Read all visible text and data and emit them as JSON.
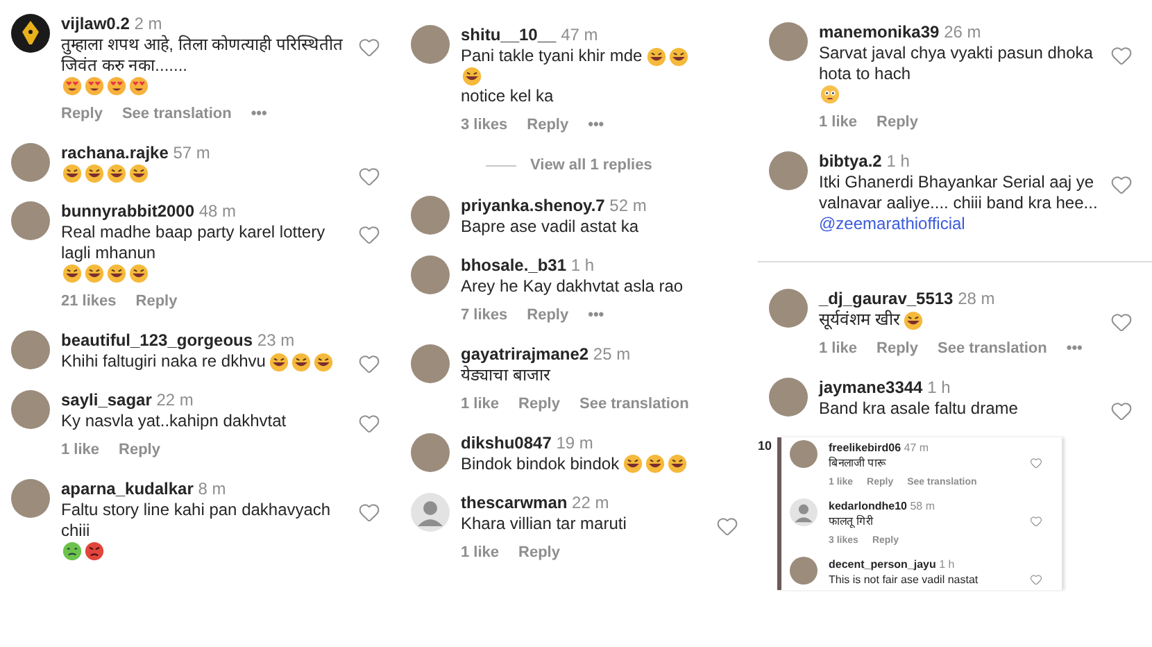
{
  "columns": [
    {
      "items": [
        {
          "kind": "comment",
          "avatar": {
            "kind": "logo"
          },
          "user": "vijlaw0.2",
          "time": "2 m",
          "text": "तुम्हाला शपथ आहे, तिला कोणत्याही परिस्थितीत जिवंत करु नका.......",
          "emojis": [
            {
              "kind": "heart-eyes"
            },
            {
              "kind": "heart-eyes"
            },
            {
              "kind": "heart-eyes"
            },
            {
              "kind": "heart-eyes"
            }
          ],
          "actions": [
            "Reply",
            "See translation",
            "•••"
          ],
          "show_heart": true
        },
        {
          "kind": "comment",
          "avatar": {
            "kind": "photo"
          },
          "user": "rachana.rajke",
          "time": "57 m",
          "emojis": [
            {
              "kind": "laugh"
            },
            {
              "kind": "laugh"
            },
            {
              "kind": "laugh"
            },
            {
              "kind": "laugh"
            }
          ],
          "show_heart": true
        },
        {
          "kind": "comment",
          "avatar": {
            "kind": "photo"
          },
          "user": "bunnyrabbit2000",
          "time": "48 m",
          "text": "Real madhe baap party karel lottery lagli mhanun",
          "emojis": [
            {
              "kind": "laugh"
            },
            {
              "kind": "laugh"
            },
            {
              "kind": "laugh"
            },
            {
              "kind": "laugh"
            }
          ],
          "actions": [
            "21 likes",
            "Reply"
          ],
          "show_heart": true
        },
        {
          "kind": "comment",
          "avatar": {
            "kind": "photo"
          },
          "user": "beautiful_123_gorgeous",
          "time": "23 m",
          "text": "Khihi faltugiri naka re dkhvu",
          "emojis": [
            {
              "kind": "laugh"
            },
            {
              "kind": "laugh"
            },
            {
              "kind": "laugh"
            }
          ],
          "show_heart": true
        },
        {
          "kind": "comment",
          "avatar": {
            "kind": "photo"
          },
          "user": "sayli_sagar",
          "time": "22 m",
          "text": "Ky nasvla yat..kahipn dakhvtat",
          "actions": [
            "1 like",
            "Reply"
          ],
          "show_heart": true
        },
        {
          "kind": "comment",
          "avatar": {
            "kind": "photo"
          },
          "user": "aparna_kudalkar",
          "time": "8 m",
          "text": "Faltu story line kahi pan dakhavyach chiii",
          "emojis": [
            {
              "kind": "sick"
            },
            {
              "kind": "angry"
            }
          ],
          "show_heart": true
        }
      ]
    },
    {
      "items": [
        {
          "kind": "comment",
          "avatar": {
            "kind": "photo"
          },
          "user": "shitu__10__",
          "time": "47 m",
          "text": "Pani takle tyani khir mde",
          "emojis": [
            {
              "kind": "laugh"
            },
            {
              "kind": "laugh"
            },
            {
              "kind": "laugh"
            }
          ],
          "text_after": "notice kel ka",
          "actions": [
            "3 likes",
            "Reply",
            "•••"
          ],
          "show_heart": false
        },
        {
          "kind": "view_replies",
          "text": "View all 1 replies"
        },
        {
          "kind": "comment",
          "avatar": {
            "kind": "photo"
          },
          "user": "priyanka.shenoy.7",
          "time": "52 m",
          "text": "Bapre ase vadil astat ka",
          "show_heart": false
        },
        {
          "kind": "comment",
          "avatar": {
            "kind": "photo"
          },
          "user": "bhosale._b31",
          "time": "1 h",
          "text": "Arey he Kay dakhvtat asla rao",
          "actions": [
            "7 likes",
            "Reply",
            "•••"
          ],
          "show_heart": false
        },
        {
          "kind": "comment",
          "avatar": {
            "kind": "photo"
          },
          "user": "gayatrirajmane2",
          "time": "25 m",
          "text": "येड्याचा बाजार",
          "actions": [
            "1 like",
            "Reply",
            "See translation"
          ],
          "show_heart": false
        },
        {
          "kind": "comment",
          "avatar": {
            "kind": "photo"
          },
          "user": "dikshu0847",
          "time": "19 m",
          "text": "Bindok bindok bindok",
          "emojis": [
            {
              "kind": "laugh"
            },
            {
              "kind": "laugh"
            },
            {
              "kind": "laugh"
            }
          ],
          "show_heart": false
        },
        {
          "kind": "comment",
          "avatar": {
            "kind": "default"
          },
          "user": "thescarwman",
          "time": "22 m",
          "text": "Khara villian tar maruti",
          "actions": [
            "1 like",
            "Reply"
          ],
          "show_heart": true
        }
      ]
    },
    {
      "items": [
        {
          "kind": "comment",
          "avatar": {
            "kind": "photo"
          },
          "user": "manemonika39",
          "time": "26 m",
          "text": "Sarvat javal chya vyakti pasun dhoka hota to hach",
          "emojis": [
            {
              "kind": "flushed"
            }
          ],
          "actions": [
            "1 like",
            "Reply"
          ],
          "show_heart": true
        },
        {
          "kind": "comment",
          "avatar": {
            "kind": "photo"
          },
          "user": "bibtya.2",
          "time": "1 h",
          "text": "Itki Ghanerdi Bhayankar Serial aaj ye valnavar aaliye.... chiii band kra hee...",
          "mention": "@zeemarathiofficial",
          "show_heart": true
        },
        {
          "kind": "divider"
        },
        {
          "kind": "comment",
          "avatar": {
            "kind": "photo"
          },
          "user": "_dj_gaurav_5513",
          "time": "28 m",
          "text": "सूर्यवंशम खीर",
          "emojis": [
            {
              "kind": "laugh"
            }
          ],
          "actions": [
            "1 like",
            "Reply",
            "See translation",
            "•••"
          ],
          "show_heart": true
        },
        {
          "kind": "comment",
          "avatar": {
            "kind": "photo"
          },
          "user": "jaymane3344",
          "time": "1 h",
          "text": "Band kra asale faltu drame",
          "show_heart": true
        },
        {
          "kind": "inset",
          "label": "10",
          "comments": [
            {
              "avatar": {
                "kind": "photo"
              },
              "user": "freelikebird06",
              "time": "47 m",
              "text": "बिनलाजी पारू",
              "actions": [
                "1 like",
                "Reply",
                "See translation"
              ],
              "show_heart": true
            },
            {
              "avatar": {
                "kind": "default"
              },
              "user": "kedarlondhe10",
              "time": "58 m",
              "text": "फालतू गिरी",
              "actions": [
                "3 likes",
                "Reply"
              ],
              "show_heart": true
            },
            {
              "avatar": {
                "kind": "photo"
              },
              "user": "decent_person_jayu",
              "time": "1 h",
              "text": "This is not fair ase vadil nastat",
              "show_heart": true
            }
          ]
        }
      ]
    }
  ]
}
